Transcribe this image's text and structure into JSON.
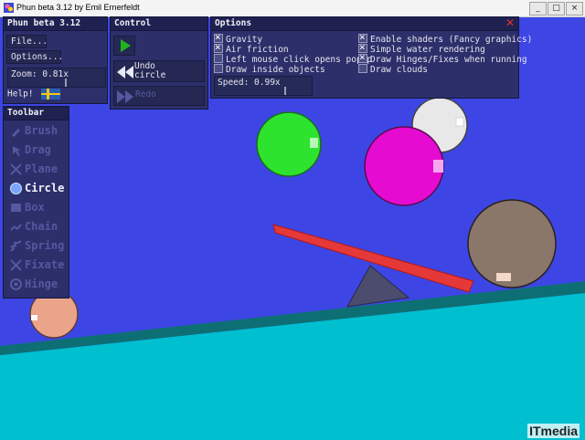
{
  "window": {
    "title": "Phun beta 3.12 by Emil Ernerfeldt",
    "minimize_glyph": "_",
    "maximize_glyph": "□",
    "close_glyph": "×"
  },
  "main_panel": {
    "title": "Phun beta 3.12",
    "file_label": "File...",
    "options_label": "Options...",
    "zoom_label": "Zoom: 0.81x",
    "help_label": "Help!",
    "language_flag": "swedish-flag"
  },
  "control_panel": {
    "title": "Control",
    "play_icon": "play-icon",
    "undo_label_line1": "Undo",
    "undo_label_line2": "circle",
    "redo_label": "Redo"
  },
  "options_panel": {
    "title": "Options",
    "close_glyph": "✕",
    "left_options": [
      {
        "label": "Gravity",
        "checked": true
      },
      {
        "label": "Air friction",
        "checked": true
      },
      {
        "label": "Left mouse click opens popup",
        "checked": false
      },
      {
        "label": "Draw inside objects",
        "checked": false
      }
    ],
    "right_options": [
      {
        "label": "Enable shaders (Fancy graphics)",
        "checked": true
      },
      {
        "label": "Simple water rendering",
        "checked": true
      },
      {
        "label": "Draw Hinges/Fixes when running",
        "checked": true
      },
      {
        "label": "Draw clouds",
        "checked": false
      }
    ],
    "speed_label": "Speed: 0.99x"
  },
  "toolbar": {
    "title": "Toolbar",
    "active_tool": "Circle",
    "tools": [
      {
        "label": "Brush",
        "icon": "brush-icon"
      },
      {
        "label": "Drag",
        "icon": "drag-icon"
      },
      {
        "label": "Plane",
        "icon": "plane-icon"
      },
      {
        "label": "Circle",
        "icon": "circle-icon"
      },
      {
        "label": "Box",
        "icon": "box-icon"
      },
      {
        "label": "Chain",
        "icon": "chain-icon"
      },
      {
        "label": "Spring",
        "icon": "spring-icon"
      },
      {
        "label": "Fixate",
        "icon": "fixate-icon"
      },
      {
        "label": "Hinge",
        "icon": "hinge-icon"
      }
    ]
  },
  "colors": {
    "sky": "#3d46e5",
    "water": "#00bfcf",
    "ground_edge": "#0d6f74",
    "panel": "#2c2f6a",
    "green_ball": "#2ee32e",
    "magenta_ball": "#e60bd0",
    "white_ball": "#e8e8e8",
    "brown_ball": "#8a776a",
    "peach_ball": "#eaa48a",
    "plank": "#e53838",
    "wedge": "#4b4c6e"
  },
  "watermark": "ITmedia"
}
